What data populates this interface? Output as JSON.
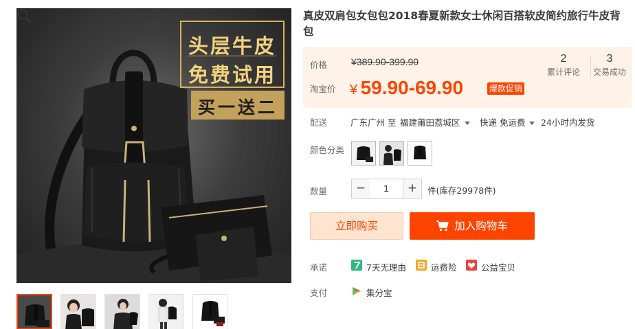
{
  "product": {
    "title": "真皮双肩包女包包2018春夏新款女士休闲百搭软皮简约旅行牛皮背包"
  },
  "image": {
    "promo_line1": "头层牛皮",
    "promo_line2": "免费试用",
    "promo_banner": "买一送二"
  },
  "price": {
    "label": "价格",
    "original": "¥389.90-399.90",
    "promo_label": "淘宝价",
    "currency": "¥",
    "promo": "59.90-69.90",
    "tag": "爆款促销",
    "accent_color": "#ff4400"
  },
  "stats": [
    {
      "value": "2",
      "label": "累计评论"
    },
    {
      "value": "3",
      "label": "交易成功"
    }
  ],
  "shipping": {
    "label": "配送",
    "from": "广东广州 至",
    "to": "福建莆田荔城区",
    "method": "快递 免运费",
    "dispatch": "24小时内发货"
  },
  "sku": {
    "label": "颜色分类"
  },
  "quantity": {
    "label": "数量",
    "minus": "−",
    "value": "1",
    "plus": "+",
    "stock": "件(库存29978件)"
  },
  "actions": {
    "buy_now": "立即购买",
    "add_to_cart": "加入购物车"
  },
  "promise": {
    "label": "承诺",
    "items": [
      {
        "text": "7天无理由",
        "icon": "seven-days-icon"
      },
      {
        "text": "运费险",
        "icon": "freight-insurance-icon"
      },
      {
        "text": "公益宝贝",
        "icon": "charity-icon"
      }
    ]
  },
  "payment": {
    "label": "支付",
    "method": "集分宝",
    "icon": "jifenbao-icon"
  }
}
